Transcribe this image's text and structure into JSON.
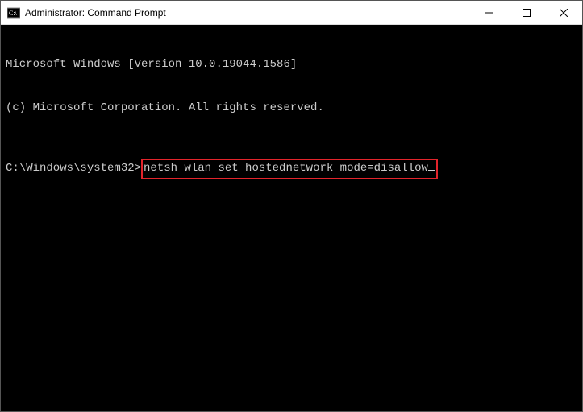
{
  "titlebar": {
    "title": "Administrator: Command Prompt"
  },
  "console": {
    "line1": "Microsoft Windows [Version 10.0.19044.1586]",
    "line2": "(c) Microsoft Corporation. All rights reserved.",
    "prompt": "C:\\Windows\\system32>",
    "command": "netsh wlan set hostednetwork mode=disallow"
  }
}
